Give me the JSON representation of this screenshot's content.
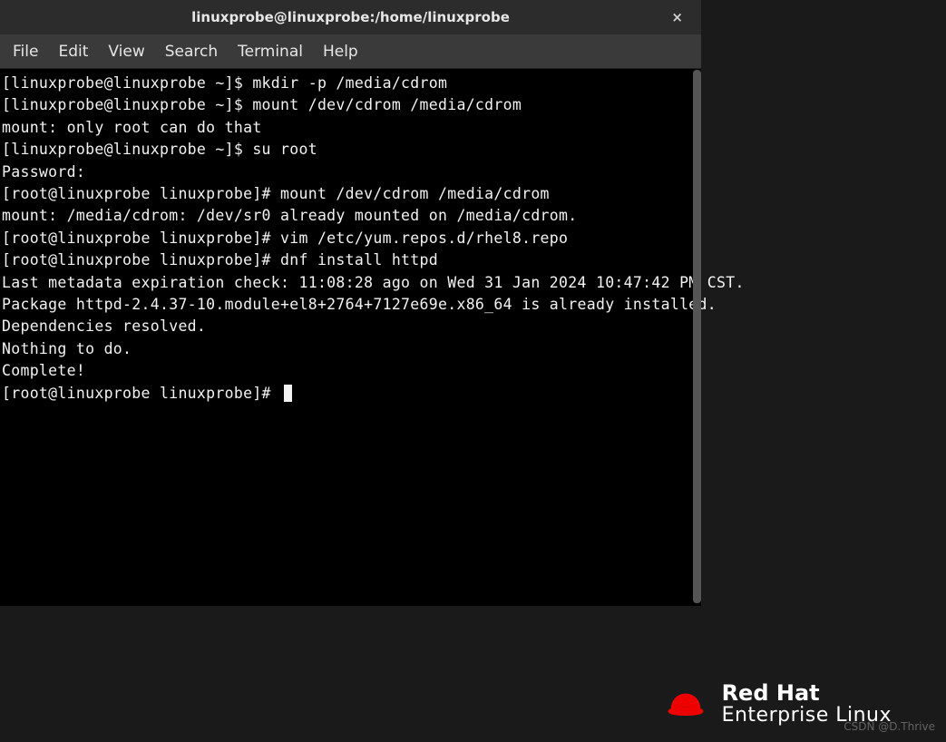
{
  "window": {
    "title": "linuxprobe@linuxprobe:/home/linuxprobe",
    "close_label": "×"
  },
  "menu": {
    "items": [
      "File",
      "Edit",
      "View",
      "Search",
      "Terminal",
      "Help"
    ]
  },
  "terminal": {
    "lines": [
      "[linuxprobe@linuxprobe ~]$ mkdir -p /media/cdrom",
      "[linuxprobe@linuxprobe ~]$ mount /dev/cdrom /media/cdrom",
      "mount: only root can do that",
      "[linuxprobe@linuxprobe ~]$ su root",
      "Password:",
      "[root@linuxprobe linuxprobe]# mount /dev/cdrom /media/cdrom",
      "mount: /media/cdrom: /dev/sr0 already mounted on /media/cdrom.",
      "[root@linuxprobe linuxprobe]# vim /etc/yum.repos.d/rhel8.repo",
      "[root@linuxprobe linuxprobe]# dnf install httpd",
      "Last metadata expiration check: 11:08:28 ago on Wed 31 Jan 2024 10:47:42 PM CST.",
      "Package httpd-2.4.37-10.module+el8+2764+7127e69e.x86_64 is already installed.",
      "Dependencies resolved.",
      "Nothing to do.",
      "Complete!",
      "[root@linuxprobe linuxprobe]# "
    ]
  },
  "branding": {
    "line1": "Red Hat",
    "line2": "Enterprise Linux",
    "hat_color": "#ee0000"
  },
  "watermark": "CSDN @D.Thrive"
}
